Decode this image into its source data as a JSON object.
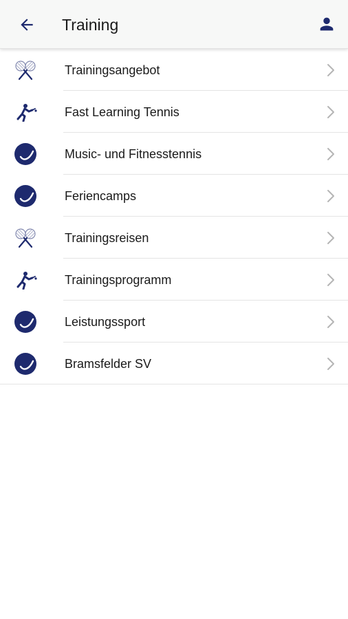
{
  "header": {
    "title": "Training",
    "back_icon": "arrow-left-icon",
    "profile_icon": "person-icon"
  },
  "colors": {
    "accent": "#1e2a6e",
    "header_bg": "#f7f8f7",
    "text": "#1a1a1a",
    "chevron": "#b5b5b5",
    "divider": "#e4e4e4"
  },
  "items": [
    {
      "label": "Trainingsangebot",
      "icon": "crossed-rackets-icon"
    },
    {
      "label": "Fast Learning Tennis",
      "icon": "tennis-player-icon"
    },
    {
      "label": "Music- und Fitnesstennis",
      "icon": "tennis-ball-icon"
    },
    {
      "label": "Feriencamps",
      "icon": "tennis-ball-icon"
    },
    {
      "label": "Trainingsreisen",
      "icon": "crossed-rackets-icon"
    },
    {
      "label": "Trainingsprogramm",
      "icon": "tennis-player-icon"
    },
    {
      "label": "Leistungssport",
      "icon": "tennis-ball-icon"
    },
    {
      "label": "Bramsfelder SV",
      "icon": "tennis-ball-icon"
    }
  ]
}
